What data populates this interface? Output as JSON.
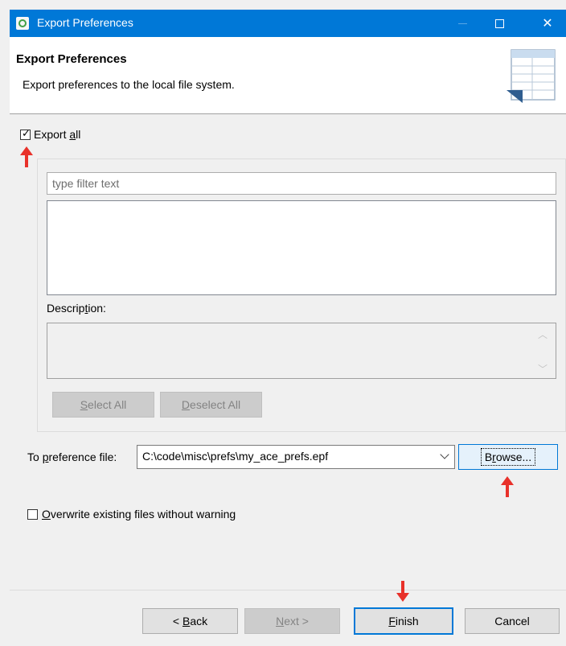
{
  "window": {
    "title": "Export Preferences",
    "close_glyph": "✕",
    "accent_color": "#0078d7"
  },
  "banner": {
    "title": "Export Preferences",
    "description": "Export preferences to the local file system.",
    "image_icon": "wizard-banner-table-icon"
  },
  "export_all": {
    "checked": true,
    "check_glyph": "✓",
    "label_pre": "Export ",
    "label_mnemonic": "a",
    "label_post": "ll"
  },
  "filter": {
    "placeholder": "type filter text",
    "value": ""
  },
  "description": {
    "label_pre": "Descrip",
    "label_mnemonic": "t",
    "label_post": "ion:",
    "scroll_up": "︿",
    "scroll_down": "﹀"
  },
  "selection_buttons": {
    "select_all_mnemonic": "S",
    "select_all_rest": "elect All",
    "deselect_all_mnemonic": "D",
    "deselect_all_rest": "eselect All"
  },
  "preference_file": {
    "label_pre": "To ",
    "label_mnemonic": "p",
    "label_post": "reference file:",
    "value": "C:\\code\\misc\\prefs\\my_ace_prefs.epf",
    "browse_pre": "B",
    "browse_mnemonic": "r",
    "browse_post": "owse..."
  },
  "overwrite": {
    "checked": false,
    "label_mnemonic": "O",
    "label_rest": "verwrite existing files without warning"
  },
  "footer": {
    "back_pre": "< ",
    "back_mnemonic": "B",
    "back_rest": "ack",
    "next_mnemonic": "N",
    "next_rest": "ext >",
    "finish_mnemonic": "F",
    "finish_rest": "inish",
    "cancel": "Cancel"
  },
  "annotations": {
    "arrow_color": "#e8312a"
  }
}
